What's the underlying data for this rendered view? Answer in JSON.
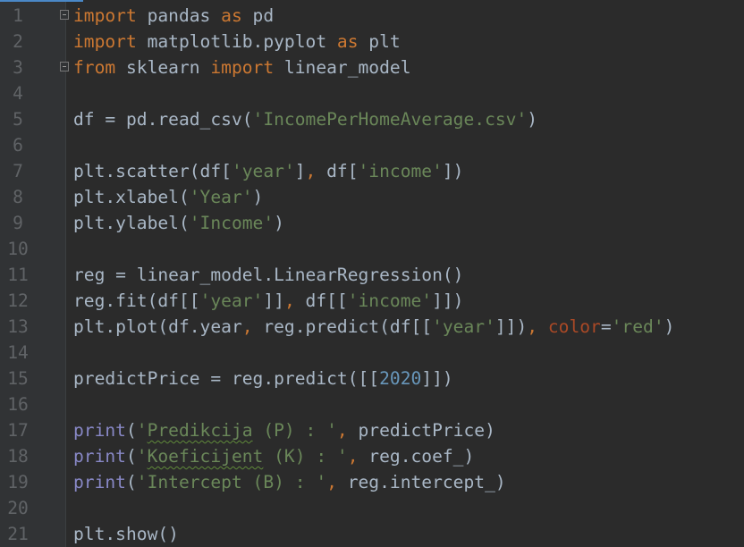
{
  "editor": {
    "lines": [
      {
        "n": "1",
        "fold": true,
        "tokens": [
          [
            "kw",
            "import"
          ],
          [
            "txt",
            " pandas "
          ],
          [
            "kw",
            "as"
          ],
          [
            "txt",
            " pd"
          ]
        ]
      },
      {
        "n": "2",
        "tokens": [
          [
            "kw",
            "import"
          ],
          [
            "txt",
            " matplotlib.pyplot "
          ],
          [
            "kw",
            "as"
          ],
          [
            "txt",
            " plt"
          ]
        ]
      },
      {
        "n": "3",
        "fold": true,
        "tokens": [
          [
            "kw",
            "from"
          ],
          [
            "txt",
            " sklearn "
          ],
          [
            "kw",
            "import"
          ],
          [
            "txt",
            " linear_model"
          ]
        ]
      },
      {
        "n": "4",
        "tokens": []
      },
      {
        "n": "5",
        "tokens": [
          [
            "txt",
            "df = pd.read_csv("
          ],
          [
            "str",
            "'IncomePerHomeAverage.csv'"
          ],
          [
            "txt",
            ")"
          ]
        ]
      },
      {
        "n": "6",
        "tokens": []
      },
      {
        "n": "7",
        "tokens": [
          [
            "txt",
            "plt.scatter(df["
          ],
          [
            "str",
            "'year'"
          ],
          [
            "txt",
            "]"
          ],
          [
            "punc",
            ","
          ],
          [
            "txt",
            " df["
          ],
          [
            "str",
            "'income'"
          ],
          [
            "txt",
            "])"
          ]
        ]
      },
      {
        "n": "8",
        "tokens": [
          [
            "txt",
            "plt.xlabel("
          ],
          [
            "str",
            "'Year'"
          ],
          [
            "txt",
            ")"
          ]
        ]
      },
      {
        "n": "9",
        "tokens": [
          [
            "txt",
            "plt.ylabel("
          ],
          [
            "str",
            "'Income'"
          ],
          [
            "txt",
            ")"
          ]
        ]
      },
      {
        "n": "10",
        "tokens": []
      },
      {
        "n": "11",
        "tokens": [
          [
            "txt",
            "reg = linear_model.LinearRegression()"
          ]
        ]
      },
      {
        "n": "12",
        "tokens": [
          [
            "txt",
            "reg.fit(df[["
          ],
          [
            "str",
            "'year'"
          ],
          [
            "txt",
            "]]"
          ],
          [
            "punc",
            ","
          ],
          [
            "txt",
            " df[["
          ],
          [
            "str",
            "'income'"
          ],
          [
            "txt",
            "]])"
          ]
        ]
      },
      {
        "n": "13",
        "tokens": [
          [
            "txt",
            "plt.plot(df.year"
          ],
          [
            "punc",
            ","
          ],
          [
            "txt",
            " reg.predict(df[["
          ],
          [
            "str",
            "'year'"
          ],
          [
            "txt",
            "]])"
          ],
          [
            "punc",
            ","
          ],
          [
            "txt",
            " "
          ],
          [
            "kwarg",
            "color"
          ],
          [
            "txt",
            "="
          ],
          [
            "str",
            "'red'"
          ],
          [
            "txt",
            ")"
          ]
        ]
      },
      {
        "n": "14",
        "tokens": []
      },
      {
        "n": "15",
        "tokens": [
          [
            "txt",
            "predictPrice = reg.predict([["
          ],
          [
            "num",
            "2020"
          ],
          [
            "txt",
            "]])"
          ]
        ]
      },
      {
        "n": "16",
        "tokens": []
      },
      {
        "n": "17",
        "tokens": [
          [
            "bi",
            "print"
          ],
          [
            "txt",
            "("
          ],
          [
            "str",
            "'"
          ],
          [
            "str typo",
            "Predikcija"
          ],
          [
            "str",
            " (P) : '"
          ],
          [
            "punc",
            ","
          ],
          [
            "txt",
            " predictPrice)"
          ]
        ]
      },
      {
        "n": "18",
        "tokens": [
          [
            "bi",
            "print"
          ],
          [
            "txt",
            "("
          ],
          [
            "str",
            "'"
          ],
          [
            "str typo",
            "Koeficijent"
          ],
          [
            "str",
            " (K) : '"
          ],
          [
            "punc",
            ","
          ],
          [
            "txt",
            " reg.coef_)"
          ]
        ]
      },
      {
        "n": "19",
        "tokens": [
          [
            "bi",
            "print"
          ],
          [
            "txt",
            "("
          ],
          [
            "str",
            "'Intercept (B) : '"
          ],
          [
            "punc",
            ","
          ],
          [
            "txt",
            " reg.intercept_)"
          ]
        ]
      },
      {
        "n": "20",
        "tokens": []
      },
      {
        "n": "21",
        "tokens": [
          [
            "txt",
            "plt.show()"
          ]
        ]
      }
    ]
  },
  "colors": {
    "background": "#2b2b2b",
    "keyword": "#cc7832",
    "string": "#6a8759",
    "number": "#6897bb",
    "builtin": "#8888c6",
    "text": "#a9b7c6"
  }
}
